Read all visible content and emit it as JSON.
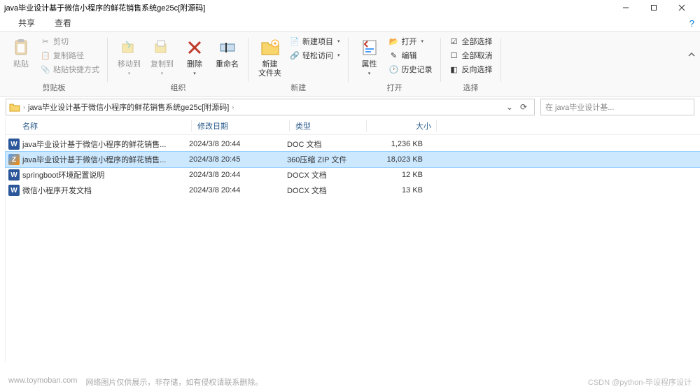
{
  "window": {
    "title": "java毕业设计基于微信小程序的鲜花销售系统ge25c[附源码]"
  },
  "tabs": {
    "share": "共享",
    "view": "查看"
  },
  "ribbon": {
    "clipboard": {
      "label": "剪贴板",
      "paste": "粘贴",
      "cut": "剪切",
      "copy_path": "复制路径",
      "paste_shortcut": "粘贴快捷方式"
    },
    "organize": {
      "label": "组织",
      "move_to": "移动到",
      "copy_to": "复制到",
      "delete": "删除",
      "rename": "重命名"
    },
    "new": {
      "label": "新建",
      "new_folder": "新建\n文件夹",
      "new_item": "新建项目",
      "easy_access": "轻松访问"
    },
    "open": {
      "label": "打开",
      "properties": "属性",
      "open_btn": "打开",
      "edit": "编辑",
      "history": "历史记录"
    },
    "select": {
      "label": "选择",
      "select_all": "全部选择",
      "select_none": "全部取消",
      "invert": "反向选择"
    }
  },
  "path": {
    "crumb": "java毕业设计基于微信小程序的鲜花销售系统ge25c[附源码]"
  },
  "search": {
    "placeholder": "在 java毕业设计基..."
  },
  "columns": {
    "name": "名称",
    "date": "修改日期",
    "type": "类型",
    "size": "大小"
  },
  "files": [
    {
      "icon": "word",
      "name": "java毕业设计基于微信小程序的鲜花销售...",
      "date": "2024/3/8 20:44",
      "type": "DOC 文档",
      "size": "1,236 KB",
      "selected": false
    },
    {
      "icon": "zip",
      "name": "java毕业设计基于微信小程序的鲜花销售...",
      "date": "2024/3/8 20:45",
      "type": "360压缩 ZIP 文件",
      "size": "18,023 KB",
      "selected": true
    },
    {
      "icon": "word",
      "name": "springboot环境配置说明",
      "date": "2024/3/8 20:44",
      "type": "DOCX 文档",
      "size": "12 KB",
      "selected": false
    },
    {
      "icon": "word",
      "name": "微信小程序开发文档",
      "date": "2024/3/8 20:44",
      "type": "DOCX 文档",
      "size": "13 KB",
      "selected": false
    }
  ],
  "footer": {
    "watermark": "www.toymoban.com",
    "note": "网络图片仅供展示，非存储，如有侵权请联系删除。",
    "credit": "CSDN @python-毕设程序设计"
  }
}
